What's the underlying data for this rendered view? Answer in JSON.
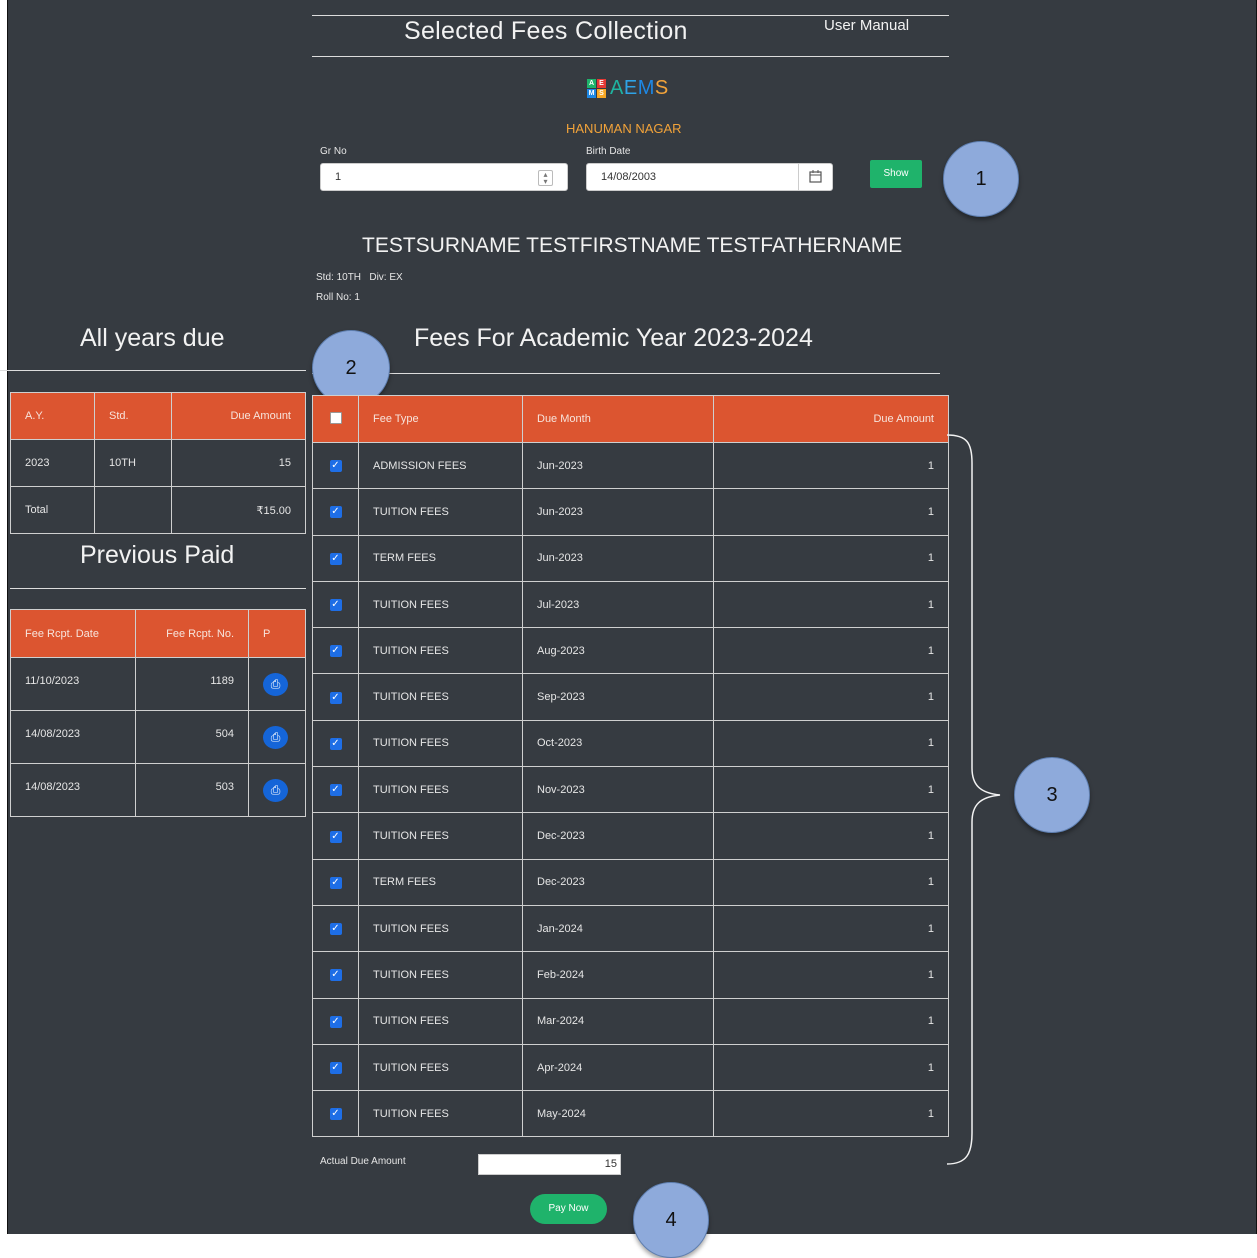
{
  "header": {
    "title": "Selected Fees Collection",
    "user_manual": "User Manual",
    "logo_text": "AEMS",
    "logo_tiles": [
      "A",
      "E",
      "M",
      "S"
    ],
    "school": "HANUMAN NAGAR"
  },
  "search": {
    "gr_label": "Gr No",
    "gr_value": "1",
    "birth_label": "Birth Date",
    "birth_value": "14/08/2003",
    "show_label": "Show",
    "calendar_icon": "calendar-icon"
  },
  "student": {
    "name": "TESTSURNAME TESTFIRSTNAME TESTFATHERNAME",
    "std_div": "Std: 10TH   Div: EX",
    "roll": "Roll No: 1"
  },
  "all_years_due": {
    "title": "All years due",
    "headers": [
      "A.Y.",
      "Std.",
      "Due Amount"
    ],
    "rows": [
      [
        "2023",
        "10TH",
        "15"
      ]
    ],
    "total_label": "Total",
    "total_value": "₹15.00"
  },
  "previous_paid": {
    "title": "Previous Paid",
    "headers": [
      "Fee Rcpt. Date",
      "Fee Rcpt. No.",
      "P"
    ],
    "rows": [
      {
        "date": "11/10/2023",
        "no": "1189"
      },
      {
        "date": "14/08/2023",
        "no": "504"
      },
      {
        "date": "14/08/2023",
        "no": "503"
      }
    ],
    "print_icon": "print-icon"
  },
  "fees": {
    "title": "Fees For Academic Year 2023-2024",
    "headers": [
      "Fee Type",
      "Due Month",
      "Due Amount"
    ],
    "rows": [
      {
        "type": "ADMISSION FEES",
        "month": "Jun-2023",
        "amount": "1",
        "checked": true
      },
      {
        "type": "TUITION FEES",
        "month": "Jun-2023",
        "amount": "1",
        "checked": true
      },
      {
        "type": "TERM FEES",
        "month": "Jun-2023",
        "amount": "1",
        "checked": true
      },
      {
        "type": "TUITION FEES",
        "month": "Jul-2023",
        "amount": "1",
        "checked": true
      },
      {
        "type": "TUITION FEES",
        "month": "Aug-2023",
        "amount": "1",
        "checked": true
      },
      {
        "type": "TUITION FEES",
        "month": "Sep-2023",
        "amount": "1",
        "checked": true
      },
      {
        "type": "TUITION FEES",
        "month": "Oct-2023",
        "amount": "1",
        "checked": true
      },
      {
        "type": "TUITION FEES",
        "month": "Nov-2023",
        "amount": "1",
        "checked": true
      },
      {
        "type": "TUITION FEES",
        "month": "Dec-2023",
        "amount": "1",
        "checked": true
      },
      {
        "type": "TERM FEES",
        "month": "Dec-2023",
        "amount": "1",
        "checked": true
      },
      {
        "type": "TUITION FEES",
        "month": "Jan-2024",
        "amount": "1",
        "checked": true
      },
      {
        "type": "TUITION FEES",
        "month": "Feb-2024",
        "amount": "1",
        "checked": true
      },
      {
        "type": "TUITION FEES",
        "month": "Mar-2024",
        "amount": "1",
        "checked": true
      },
      {
        "type": "TUITION FEES",
        "month": "Apr-2024",
        "amount": "1",
        "checked": true
      },
      {
        "type": "TUITION FEES",
        "month": "May-2024",
        "amount": "1",
        "checked": true
      }
    ],
    "actual_due_label": "Actual Due Amount",
    "actual_due_value": "15",
    "pay_now": "Pay Now"
  },
  "callouts": [
    "1",
    "2",
    "3",
    "4"
  ],
  "colors": {
    "background": "#363b41",
    "table_header": "#dc5530",
    "accent_green": "#1fb36b",
    "checkbox_blue": "#1e6ee6",
    "school_orange": "#f2a33a",
    "callout": "#8eaadb"
  }
}
